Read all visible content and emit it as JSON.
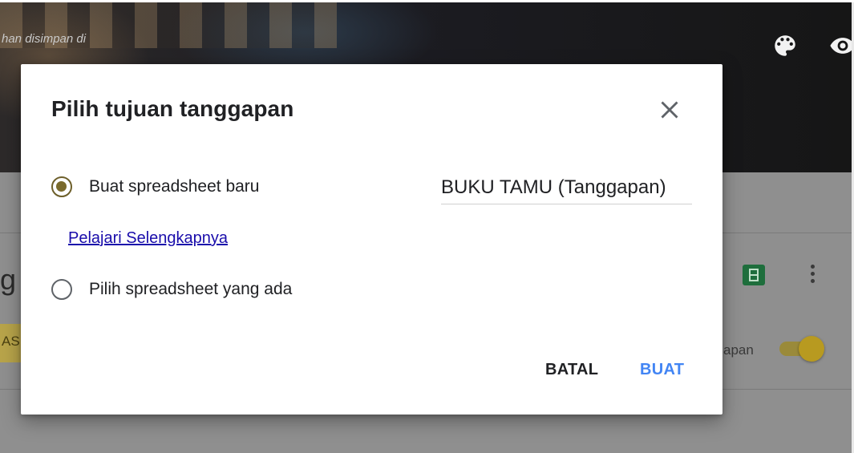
{
  "background": {
    "header_text": "han disimpan di",
    "icons": [
      "palette-icon",
      "eye-icon",
      "sheets-icon",
      "more-vert-icon"
    ],
    "partial_letter": "g",
    "partial_tab_label": "AS",
    "toggle_label": "apan",
    "toggle_on": true
  },
  "dialog": {
    "title": "Pilih tujuan tanggapan",
    "close_icon": "close-icon",
    "options": [
      {
        "label": "Buat spreadsheet baru",
        "selected": true
      },
      {
        "label": "Pilih spreadsheet yang ada",
        "selected": false
      }
    ],
    "learn_more_link": "Pelajari Selengkapnya",
    "spreadsheet_name_value": "BUKU TAMU (Tanggapan)",
    "cancel_label": "BATAL",
    "create_label": "BUAT"
  },
  "colors": {
    "accent_radio": "#7a6a2c",
    "create_button": "#4285f4",
    "link": "#1a0dab"
  }
}
